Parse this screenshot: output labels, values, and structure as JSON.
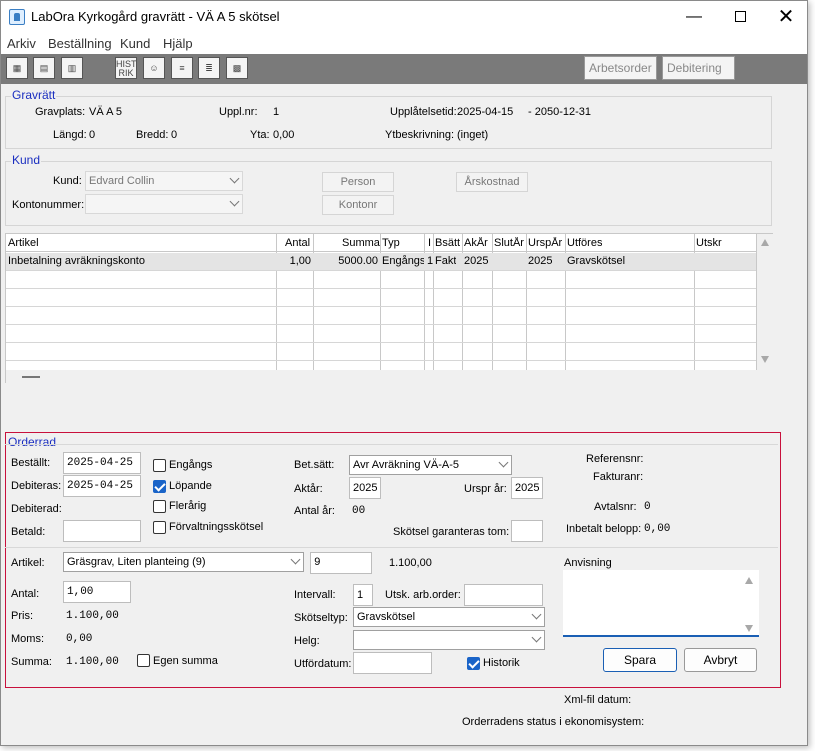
{
  "window": {
    "title": "LabOra Kyrkogård gravrätt - VÄ A  5 skötsel"
  },
  "menu": [
    "Arkiv",
    "Beställning",
    "Kund",
    "Hjälp"
  ],
  "toolbar": {
    "tb1": "",
    "tb2": "",
    "tb3": "",
    "histo": "HISTO RIK",
    "arbetsorder": "Arbetsorder",
    "debitering": "Debitering"
  },
  "gravratt": {
    "title": "Gravrätt",
    "gravplats_label": "Gravplats:",
    "gravplats": "VÄ A  5",
    "upplnr_label": "Uppl.nr:",
    "upplnr": "1",
    "upplatelsetid_label": "Upplåtelsetid:",
    "upplatelsetid_from": "2025-04-15",
    "upplatelsetid_to": "- 2050-12-31",
    "langd_label": "Längd:",
    "langd": "0",
    "bredd_label": "Bredd:",
    "bredd": "0",
    "yta_label": "Yta:",
    "yta": "0,00",
    "ytbeskrivning_label": "Ytbeskrivning:",
    "ytbeskrivning": "(inget)"
  },
  "kund": {
    "title": "Kund",
    "kund_label": "Kund:",
    "kund_value": "Edvard  Collin",
    "kontonummer_label": "Kontonummer:",
    "kontonummer_value": "",
    "person_btn": "Person",
    "kontonr_btn": "Kontonr",
    "arskostnad_btn": "Årskostnad"
  },
  "articles": {
    "headers": {
      "artikel": "Artikel",
      "antal": "Antal",
      "summa": "Summa",
      "typ": "Typ",
      "i": "I",
      "bsatt": "Bsätt",
      "akar": "AkÅr",
      "slutar": "SlutÅr",
      "ursprar": "UrspÅr",
      "utfores": "Utföres",
      "utskr": "Utskr"
    },
    "rows": [
      {
        "artikel": "Inbetalning avräkningskonto",
        "antal": "1,00",
        "summa": "5000.00",
        "typ": "Engångs",
        "i": "1",
        "bsatt": "Fakt",
        "akar": "2025",
        "slutar": "",
        "ursprar": "2025",
        "utfores": "Gravskötsel",
        "utskr": ""
      }
    ]
  },
  "orderrad": {
    "title": "Orderrad",
    "bestallt_label": "Beställt:",
    "bestallt": "2025-04-25",
    "debiteras_label": "Debiteras:",
    "debiteras": "2025-04-25",
    "debiterad_label": "Debiterad:",
    "betald_label": "Betald:",
    "betald": "",
    "engangs": "Engångs",
    "lopande": "Löpande",
    "flerarig": "Flerårig",
    "forvaltning": "Förvaltningsskötsel",
    "betsatt_label": "Bet.sätt:",
    "betsatt": "Avr Avräkning  VÄ-A-5",
    "aktar_label": "Aktår:",
    "aktar": "2025",
    "ursprar_label": "Urspr år:",
    "ursprar": "2025",
    "antalar_label": "Antal år:",
    "antalar": "00",
    "garanteras_label": "Skötsel garanteras tom:",
    "garanteras": "",
    "referensnr_label": "Referensnr:",
    "fakturanr_label": "Fakturanr:",
    "avtalsnr_label": "Avtalsnr:",
    "avtalsnr": "0",
    "inbetalt_label": "Inbetalt belopp:",
    "inbetalt": "0,00",
    "artikel_label": "Artikel:",
    "artikel": "Gräsgrav, Liten planteing (9)",
    "artikel_code": "9",
    "artikel_price": "1.100,00",
    "antal_label": "Antal:",
    "antal": "1,00",
    "pris_label": "Pris:",
    "pris": "1.100,00",
    "moms_label": "Moms:",
    "moms": "0,00",
    "summa_label": "Summa:",
    "summa": "1.100,00",
    "egen_summa": "Egen summa",
    "intervall_label": "Intervall:",
    "intervall": "1",
    "utsk_label": "Utsk. arb.order:",
    "utsk": "",
    "skotseltyp_label": "Skötseltyp:",
    "skotseltyp": "Gravskötsel",
    "helg_label": "Helg:",
    "helg": "",
    "utfordatum_label": "Utfördatum:",
    "utfordatum": "",
    "historik": "Historik",
    "anvisning_label": "Anvisning",
    "anvisning": "",
    "spara": "Spara",
    "avbryt": "Avbryt"
  },
  "footer": {
    "xml_label": "Xml-fil datum:",
    "status_label": "Orderradens status i ekonomisystem:"
  }
}
